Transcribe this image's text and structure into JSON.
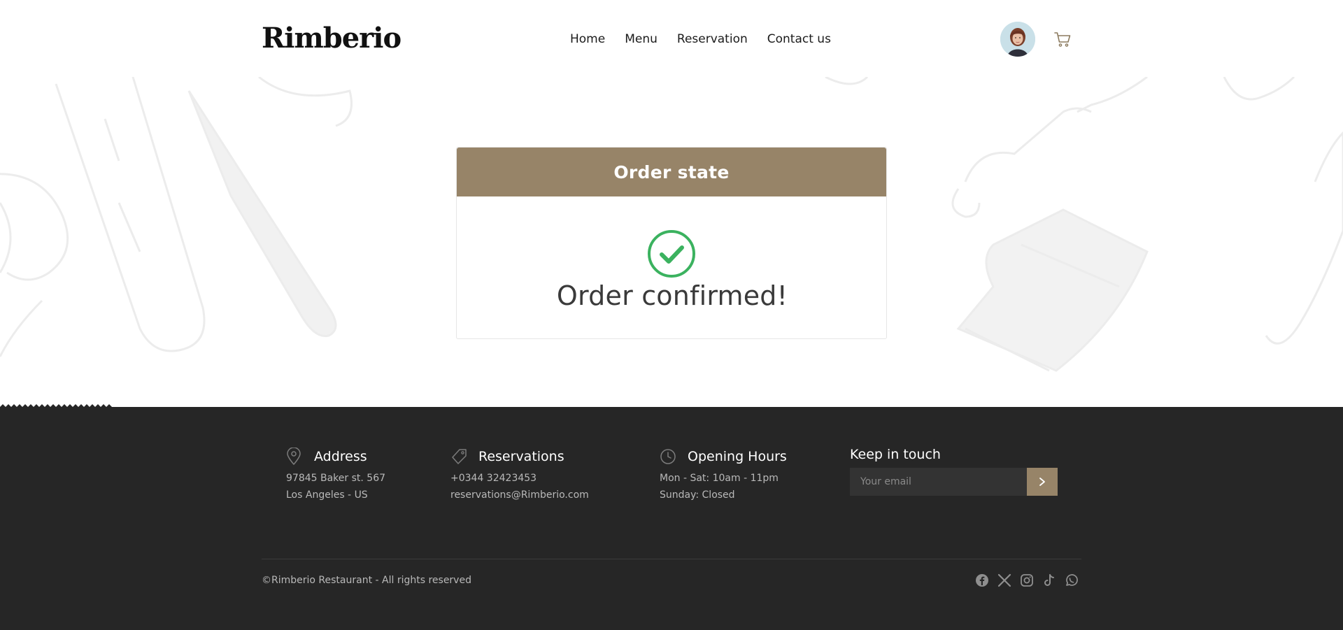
{
  "brand": {
    "logo": "Rimberio"
  },
  "nav": {
    "items": [
      {
        "label": "Home"
      },
      {
        "label": "Menu"
      },
      {
        "label": "Reservation"
      },
      {
        "label": "Contact us"
      }
    ]
  },
  "header_icons": [
    "avatar",
    "cart-icon"
  ],
  "order": {
    "title": "Order state",
    "status_icon": "check-circle-icon",
    "status_text": "Order confirmed!"
  },
  "footer": {
    "address": {
      "icon": "map-pin-icon",
      "title": "Address",
      "line1": "97845 Baker st. 567",
      "line2": "Los Angeles - US"
    },
    "reservations": {
      "icon": "tag-icon",
      "title": "Reservations",
      "line1": "+0344 32423453",
      "line2": "reservations@Rimberio.com"
    },
    "hours": {
      "icon": "clock-icon",
      "title": "Opening Hours",
      "line1": "Mon - Sat: 10am - 11pm",
      "line2": "Sunday: Closed"
    },
    "newsletter": {
      "title": "Keep in touch",
      "placeholder": "Your email",
      "submit_icon": "chevron-right-icon"
    },
    "copyright": "©Rimberio Restaurant - All rights reserved",
    "socials": [
      "facebook-icon",
      "x-icon",
      "instagram-icon",
      "tiktok-icon",
      "whatsapp-icon"
    ]
  },
  "colors": {
    "accent": "#978468",
    "success": "#3bb25f",
    "footer_bg": "#262626",
    "text_dark": "#3a3a3a"
  }
}
